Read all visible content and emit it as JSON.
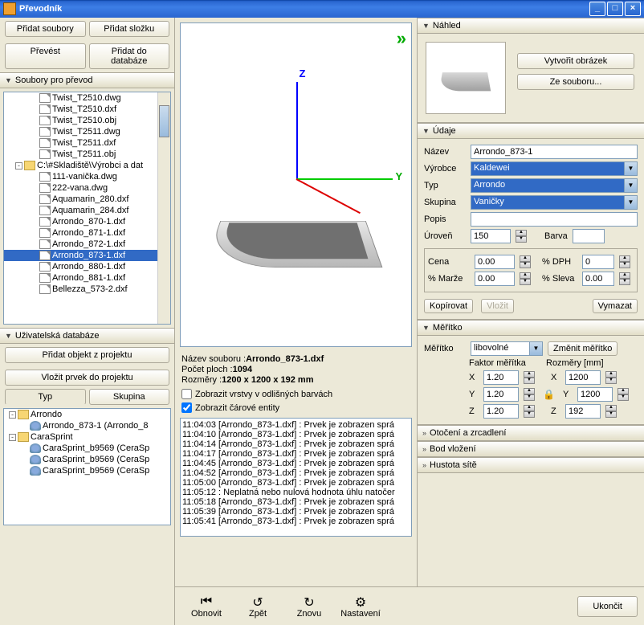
{
  "window": {
    "title": "Převodník"
  },
  "toolbar": {
    "add_files": "Přidat soubory",
    "add_folder": "Přidat složku",
    "convert": "Převést",
    "add_to_db": "Přidat do databáze"
  },
  "files_panel": {
    "title": "Soubory pro převod",
    "items": [
      {
        "indent": 40,
        "icon": "f",
        "name": "Twist_T2510.dwg"
      },
      {
        "indent": 40,
        "icon": "f",
        "name": "Twist_T2510.dxf"
      },
      {
        "indent": 40,
        "icon": "f",
        "name": "Twist_T2510.obj"
      },
      {
        "indent": 40,
        "icon": "f",
        "name": "Twist_T2511.dwg"
      },
      {
        "indent": 40,
        "icon": "f",
        "name": "Twist_T2511.dxf"
      },
      {
        "indent": 40,
        "icon": "f",
        "name": "Twist_T2511.obj"
      },
      {
        "indent": 10,
        "icon": "fd",
        "name": "C:\\#Skladiště\\Výrobci a dat",
        "pm": "-"
      },
      {
        "indent": 40,
        "icon": "f",
        "name": "111-vanička.dwg"
      },
      {
        "indent": 40,
        "icon": "f",
        "name": "222-vana.dwg"
      },
      {
        "indent": 40,
        "icon": "f",
        "name": "Aquamarin_280.dxf"
      },
      {
        "indent": 40,
        "icon": "f",
        "name": "Aquamarin_284.dxf"
      },
      {
        "indent": 40,
        "icon": "f",
        "name": "Arrondo_870-1.dxf"
      },
      {
        "indent": 40,
        "icon": "f",
        "name": "Arrondo_871-1.dxf"
      },
      {
        "indent": 40,
        "icon": "f",
        "name": "Arrondo_872-1.dxf"
      },
      {
        "indent": 40,
        "icon": "f",
        "name": "Arrondo_873-1.dxf",
        "sel": true
      },
      {
        "indent": 40,
        "icon": "f",
        "name": "Arrondo_880-1.dxf"
      },
      {
        "indent": 40,
        "icon": "f",
        "name": "Arrondo_881-1.dxf"
      },
      {
        "indent": 40,
        "icon": "f",
        "name": "Bellezza_573-2.dxf"
      }
    ]
  },
  "db_panel": {
    "title": "Uživatelská databáze",
    "add_obj": "Přidat objekt z projektu",
    "insert_obj": "Vložit prvek do projektu",
    "tab_typ": "Typ",
    "tab_skupina": "Skupina",
    "items": [
      {
        "indent": 2,
        "icon": "fd",
        "name": "Arrondo",
        "pm": "-"
      },
      {
        "indent": 28,
        "icon": "db",
        "name": "Arrondo_873-1 (Arrondo_8"
      },
      {
        "indent": 2,
        "icon": "fd",
        "name": "CaraSprint",
        "pm": "-"
      },
      {
        "indent": 28,
        "icon": "db",
        "name": "CaraSprint_b9569 (CeraSp"
      },
      {
        "indent": 28,
        "icon": "db",
        "name": "CaraSprint_b9569 (CeraSp"
      },
      {
        "indent": 28,
        "icon": "db",
        "name": "CaraSprint_b9569 (CeraSp"
      }
    ]
  },
  "info": {
    "name_lbl": "Název souboru :",
    "name": "Arrondo_873-1.dxf",
    "faces_lbl": "Počet ploch :",
    "faces": "1094",
    "dims_lbl": "Rozměry :",
    "dims": "1200 x 1200 x 192 mm",
    "cb_layers": "Zobrazit vrstvy v odlišných barvách",
    "cb_lines": "Zobrazit čárové entity"
  },
  "log": [
    "11:04:03 [Arrondo_873-1.dxf] : Prvek je zobrazen sprá",
    "11:04:10 [Arrondo_873-1.dxf] : Prvek je zobrazen sprá",
    "11:04:14 [Arrondo_873-1.dxf] : Prvek je zobrazen sprá",
    "11:04:17 [Arrondo_873-1.dxf] : Prvek je zobrazen sprá",
    "11:04:45 [Arrondo_873-1.dxf] : Prvek je zobrazen sprá",
    "11:04:52 [Arrondo_873-1.dxf] : Prvek je zobrazen sprá",
    "11:05:00 [Arrondo_873-1.dxf] : Prvek je zobrazen sprá",
    "11:05:12 : Neplatná nebo nulová hodnota úhlu natočer",
    "11:05:18 [Arrondo_873-1.dxf] : Prvek je zobrazen sprá",
    "11:05:39 [Arrondo_873-1.dxf] : Prvek je zobrazen sprá",
    "11:05:41 [Arrondo_873-1.dxf] : Prvek je zobrazen sprá"
  ],
  "preview": {
    "title": "Náhled",
    "create_img": "Vytvořit obrázek",
    "from_file": "Ze souboru..."
  },
  "props": {
    "title": "Údaje",
    "name_lbl": "Název",
    "name": "Arrondo_873-1",
    "maker_lbl": "Výrobce",
    "maker": "Kaldewei",
    "type_lbl": "Typ",
    "type": "Arrondo",
    "group_lbl": "Skupina",
    "group": "Vaničky",
    "desc_lbl": "Popis",
    "desc": "",
    "level_lbl": "Úroveň",
    "level": "150",
    "color_lbl": "Barva",
    "price_lbl": "Cena",
    "price": "0.00",
    "vat_lbl": "% DPH",
    "vat": "0",
    "margin_lbl": "% Marže",
    "margin": "0.00",
    "disc_lbl": "% Sleva",
    "disc": "0.00",
    "copy": "Kopírovat",
    "paste": "Vložit",
    "delete": "Vymazat"
  },
  "scale": {
    "title": "Měřítko",
    "lbl": "Měřítko",
    "val": "libovolné",
    "change": "Změnit měřítko",
    "factor_hdr": "Faktor měřítka",
    "dims_hdr": "Rozměry [mm]",
    "x": "X",
    "y": "Y",
    "z": "Z",
    "fx": "1.20",
    "fy": "1.20",
    "fz": "1.20",
    "dx": "1200",
    "dy": "1200",
    "dz": "192"
  },
  "collapsed": {
    "rot": "Otočení a zrcadlení",
    "ins": "Bod vložení",
    "mesh": "Hustota sítě"
  },
  "footer": {
    "refresh": "Obnovit",
    "undo": "Zpět",
    "redo": "Znovu",
    "settings": "Nastavení",
    "close": "Ukončit"
  }
}
